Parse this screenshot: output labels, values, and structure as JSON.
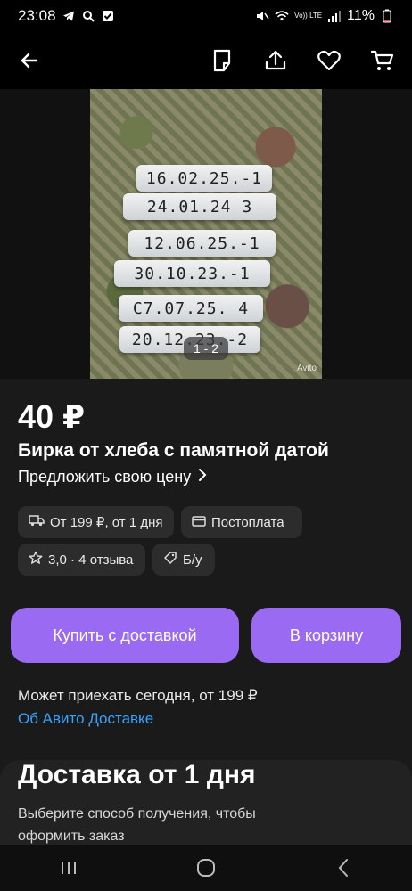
{
  "status_bar": {
    "time": "23:08",
    "network": "Vo)) LTE",
    "battery": "11%"
  },
  "gallery": {
    "tags": [
      "16.02.25.-1",
      "24.01.24 3",
      "12.06.25.-1",
      "30.10.23.-1",
      "C7.07.25. 4",
      "20.12.23.-2"
    ],
    "watermark": "Avito",
    "counter": "1 - 2"
  },
  "product": {
    "price": "40 ₽",
    "title": "Бирка от хлеба с памятной датой",
    "offer_link": "Предложить свою цену"
  },
  "chips": {
    "shipping": "От 199 ₽, от 1 дня",
    "payment": "Постоплата",
    "rating": "3,0 · 4 отзыва",
    "condition": "Б/у"
  },
  "buttons": {
    "buy": "Купить с доставкой",
    "cart": "В корзину"
  },
  "delivery": {
    "note": "Может приехать сегодня, от 199 ₽",
    "link": "Об Авито Доставке"
  },
  "delivery_card": {
    "title": "Доставка от 1 дня",
    "text": "Выберите способ получения, чтобы оформить заказ"
  },
  "colors": {
    "accent": "#9a6af2",
    "link": "#35a3ff",
    "background": "#1a1a1a"
  }
}
